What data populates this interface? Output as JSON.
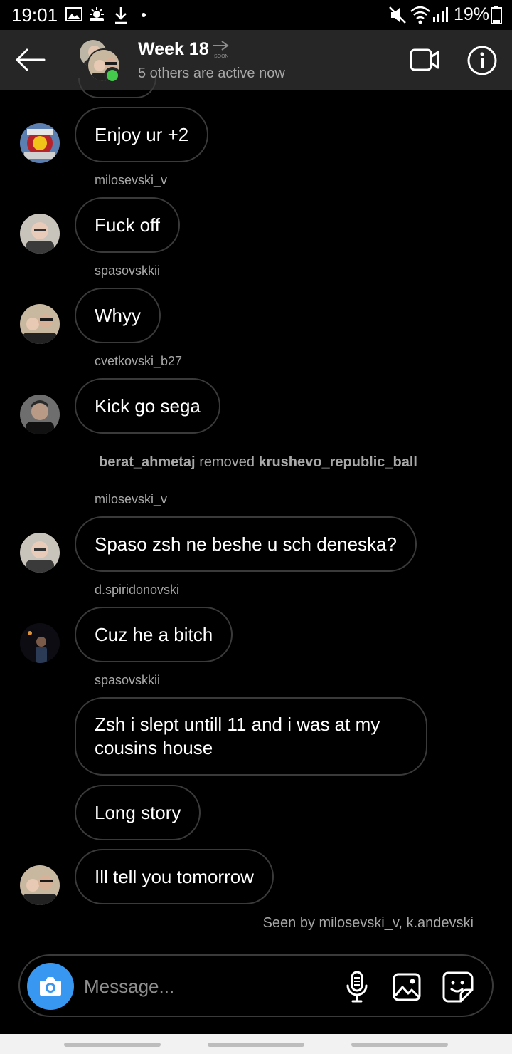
{
  "status_bar": {
    "time": "19:01",
    "battery": "19%",
    "icons": [
      "gallery-icon",
      "weather-icon",
      "download-icon",
      "dot-icon",
      "mute-icon",
      "wifi-icon",
      "signal-icon",
      "battery-icon"
    ]
  },
  "header": {
    "title": "Week 18",
    "subtitle": "5 others are active now",
    "soon_label": "SOON",
    "online_color": "#44c94d"
  },
  "messages": [
    {
      "text": "Enjoy ur +2",
      "avatar": "emblem-avatar"
    },
    {
      "username": "milosevski_v",
      "text": "Fuck off",
      "avatar": "user-avatar"
    },
    {
      "username": "spasovskkii",
      "text": "Whyy",
      "avatar": "pair-avatar"
    },
    {
      "username": "cvetkovski_b27",
      "text": "Kick go sega",
      "avatar": "user-avatar"
    },
    {
      "username": "milosevski_v",
      "text": "Spaso zsh ne beshe u sch deneska?",
      "avatar": "user-avatar"
    },
    {
      "username": "d.spiridonovski",
      "text": "Cuz he a bitch",
      "avatar": "night-avatar"
    },
    {
      "username": "spasovskkii",
      "texts": [
        "Zsh i slept untill 11 and i was at my cousins house",
        "Long story",
        "Ill tell you tomorrow"
      ],
      "avatar": "pair-avatar"
    }
  ],
  "system_message": {
    "actor": "berat_ahmetaj",
    "action": "removed",
    "target": "krushevo_republic_ball"
  },
  "seen_by": "Seen by milosevski_v, k.andevski",
  "composer": {
    "placeholder": "Message...",
    "camera_color": "#3897f0"
  }
}
